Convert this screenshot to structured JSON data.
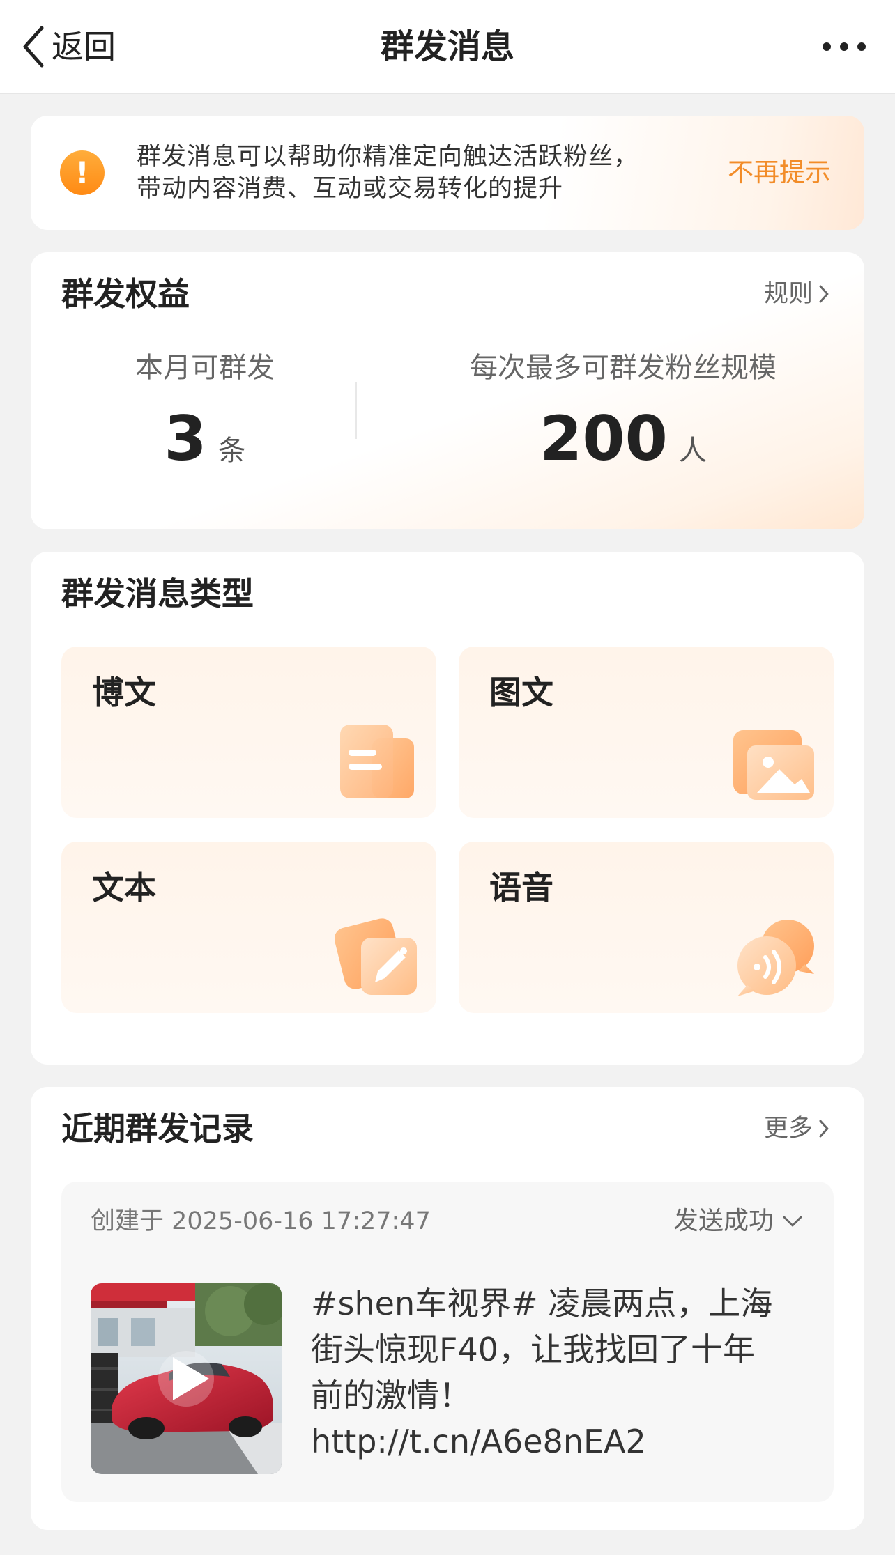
{
  "header": {
    "back_label": "返回",
    "title": "群发消息",
    "more_icon": "more-dots-icon"
  },
  "notice": {
    "icon": "warning-icon",
    "line1": "群发消息可以帮助你精准定向触达活跃粉丝，",
    "line2": "带动内容消费、互动或交易转化的提升",
    "dismiss_label": "不再提示"
  },
  "benefits": {
    "title": "群发权益",
    "rules_label": "规则",
    "stats": [
      {
        "label": "本月可群发",
        "value": "3",
        "unit": "条"
      },
      {
        "label": "每次最多可群发粉丝规模",
        "value": "200",
        "unit": "人"
      }
    ]
  },
  "types": {
    "title": "群发消息类型",
    "items": [
      {
        "label": "博文",
        "icon": "document-icon"
      },
      {
        "label": "图文",
        "icon": "image-icon"
      },
      {
        "label": "文本",
        "icon": "pencil-icon"
      },
      {
        "label": "语音",
        "icon": "voice-icon"
      }
    ]
  },
  "records": {
    "title": "近期群发记录",
    "more_label": "更多",
    "items": [
      {
        "created": "创建于 2025-06-16 17:27:47",
        "status": "发送成功",
        "text_lines": [
          "#shen车视界# 凌晨两点，上海",
          "街头惊现F40，让我找回了十年",
          "前的激情！",
          "http://t.cn/A6e8nEA2"
        ],
        "thumb_icon": "play-icon"
      }
    ]
  },
  "colors": {
    "accent": "#f28c28",
    "warning": "#ff9a1f",
    "background": "#f2f2f2",
    "card": "#ffffff",
    "tile": "#fff4ea"
  }
}
